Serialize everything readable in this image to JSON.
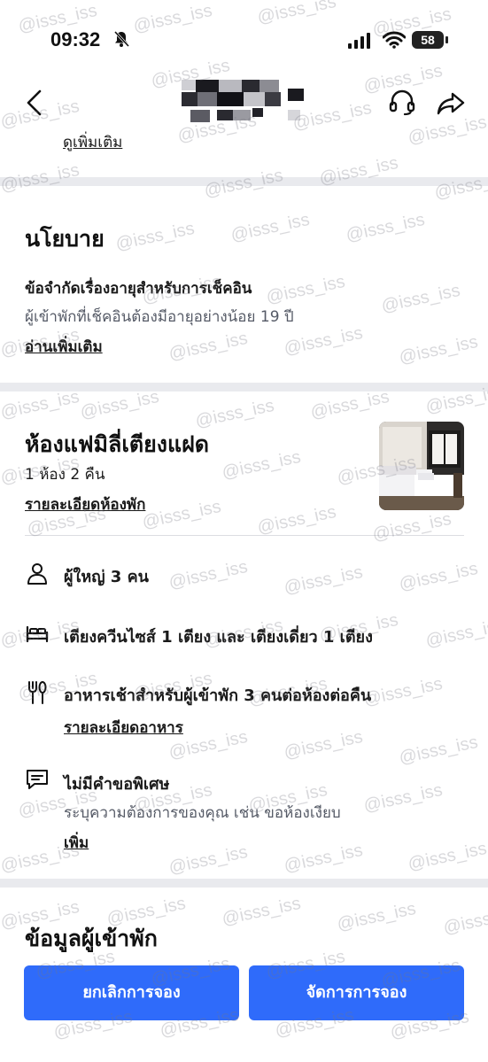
{
  "status_bar": {
    "time": "09:32",
    "battery": "58",
    "icons": [
      "bell-off-icon",
      "signal-icon",
      "wifi-icon",
      "battery-icon"
    ]
  },
  "nav": {
    "icons": [
      "back-icon",
      "headset-icon",
      "share-icon"
    ],
    "see_more": "ดูเพิ่มเติม"
  },
  "policy": {
    "title": "นโยบาย",
    "checkin_title": "ข้อจำกัดเรื่องอายุสำหรับการเช็คอิน",
    "checkin_desc": "ผู้เข้าพักที่เช็คอินต้องมีอายุอย่างน้อย 19 ปี",
    "read_more": "อ่านเพิ่มเติม"
  },
  "room": {
    "title": "ห้องแฟมิลี่เตียงแฝด",
    "summary": "1 ห้อง 2 คืน",
    "details_link": "รายละเอียดห้องพัก",
    "guests": "ผู้ใหญ่ 3 คน",
    "beds": "เตียงควีนไซส์ 1 เตียง และ เตียงเดี่ยว 1 เตียง",
    "breakfast": "อาหารเช้าสำหรับผู้เข้าพัก 3 คนต่อห้องต่อคืน",
    "meal_link": "รายละเอียดอาหาร",
    "special_title": "ไม่มีคำขอพิเศษ",
    "special_desc": "ระบุความต้องการของคุณ เช่น ขอห้องเงียบ",
    "add_link": "เพิ่ม",
    "icons": [
      "person-icon",
      "bed-icon",
      "utensils-icon",
      "message-icon"
    ]
  },
  "guest_info": {
    "title": "ข้อมูลผู้เข้าพัก"
  },
  "actions": {
    "cancel": "ยกเลิกการจอง",
    "manage": "จัดการการจอง"
  },
  "watermark": {
    "text": "@isss_iss"
  },
  "colors": {
    "primary_button": "#2f6bfa",
    "divider": "#e9eaee"
  }
}
